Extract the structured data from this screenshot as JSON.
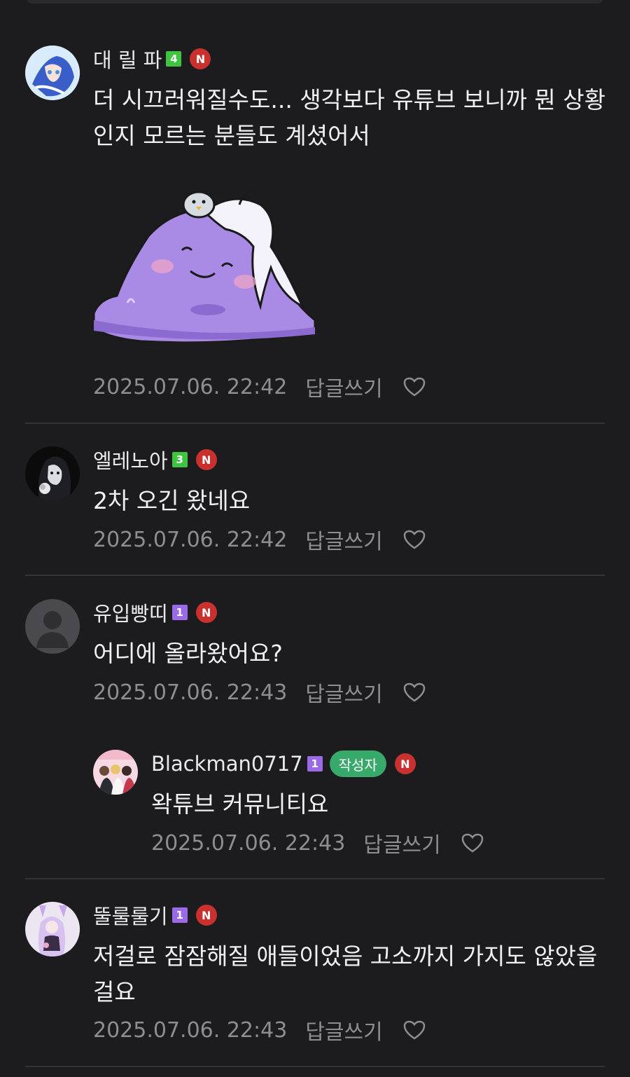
{
  "comments": [
    {
      "nickname": "대 릴 파",
      "level": "4",
      "badge_new": "N",
      "text": "더 시끄러워질수도... 생각보다 유튜브 보니까 뭔 상황인지 모르는 분들도 계셨어서",
      "date": "2025.07.06. 22:42",
      "reply_label": "답글쓰기"
    },
    {
      "nickname": "엘레노아",
      "level": "3",
      "badge_new": "N",
      "text": "2차 오긴 왔네요",
      "date": "2025.07.06. 22:42",
      "reply_label": "답글쓰기"
    },
    {
      "nickname": "유입빵띠",
      "level": "1",
      "badge_new": "N",
      "text": "어디에 올라왔어요?",
      "date": "2025.07.06. 22:43",
      "reply_label": "답글쓰기"
    },
    {
      "nickname": "Blackman0717",
      "level": "1",
      "author_badge": "작성자",
      "badge_new": "N",
      "text": "왁튜브 커뮤니티요",
      "date": "2025.07.06. 22:43",
      "reply_label": "답글쓰기"
    },
    {
      "nickname": "뚤룰룰기",
      "level": "1",
      "badge_new": "N",
      "text": "저걸로 잠잠해질 애들이었음 고소까지 가지도 않았을걸요",
      "date": "2025.07.06. 22:43",
      "reply_label": "답글쓰기"
    }
  ],
  "colors": {
    "background": "#1c1c1e",
    "level_green": "#3ec43e",
    "level_purple": "#9b6ae6",
    "new_badge": "#c9312f",
    "author_badge": "#37a96b"
  },
  "icons": [
    "heart-icon",
    "sticker-image",
    "default-avatar-icon"
  ]
}
